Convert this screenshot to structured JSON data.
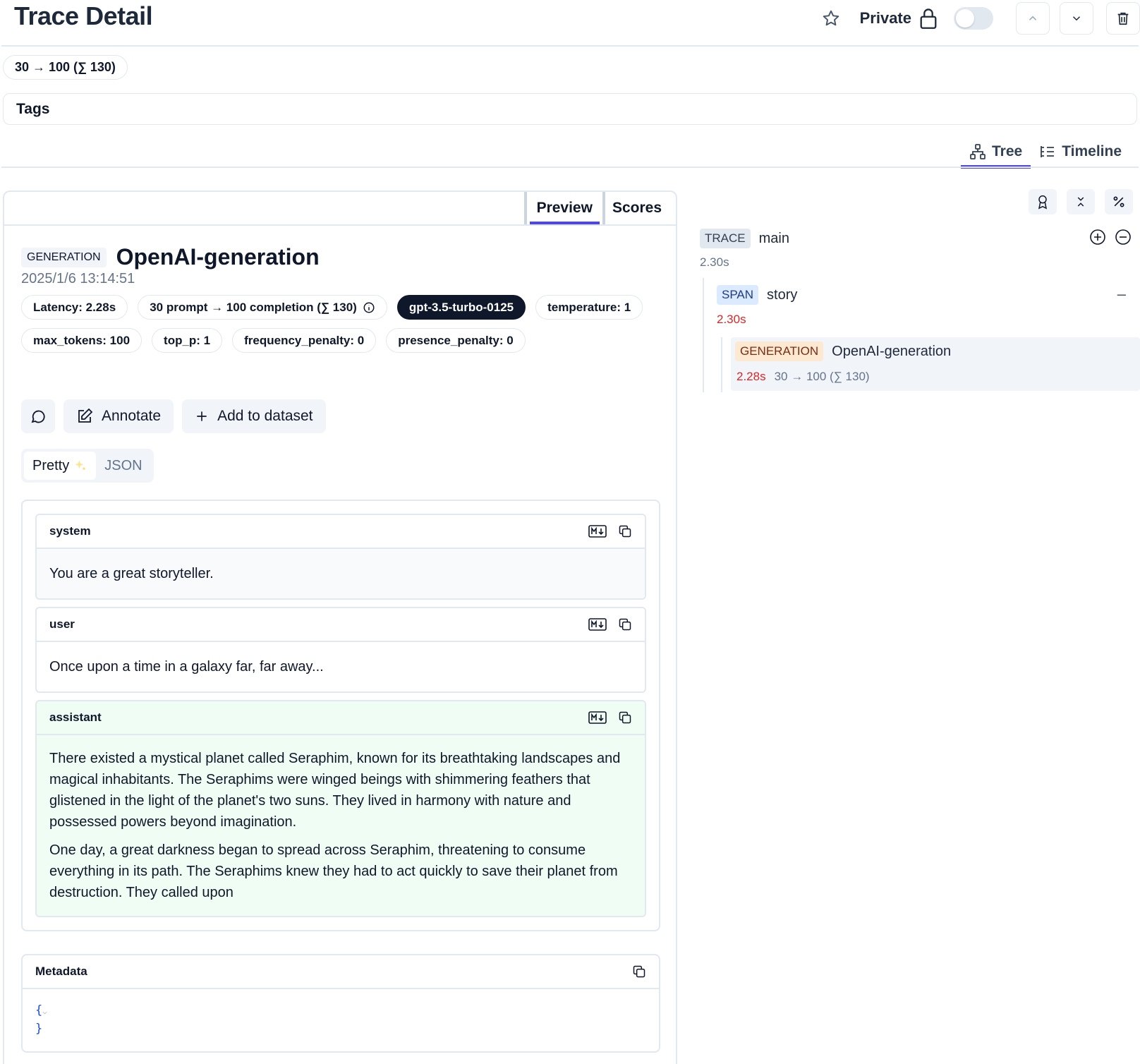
{
  "header": {
    "title": "Trace Detail",
    "private_label": "Private"
  },
  "usage_pill": "30 → 100 (∑ 130)",
  "tags_label": "Tags",
  "view_tabs": [
    {
      "label": "Tree",
      "active": true,
      "icon": "tree-icon"
    },
    {
      "label": "Timeline",
      "active": false,
      "icon": "timeline-icon"
    }
  ],
  "left_panel": {
    "tabs": [
      {
        "label": "Preview",
        "active": true
      },
      {
        "label": "Scores",
        "active": false
      }
    ],
    "observation": {
      "type": "GENERATION",
      "name": "OpenAI-generation",
      "timestamp": "2025/1/6 13:14:51"
    },
    "pills": [
      {
        "label": "Latency: 2.28s"
      },
      {
        "label": "30 prompt → 100 completion (∑ 130)",
        "has_info_icon": true
      },
      {
        "label": "gpt-3.5-turbo-0125",
        "dark": true
      },
      {
        "label": "temperature: 1"
      },
      {
        "label": "max_tokens: 100"
      },
      {
        "label": "top_p: 1"
      },
      {
        "label": "frequency_penalty: 0"
      },
      {
        "label": "presence_penalty: 0"
      }
    ],
    "actions": {
      "annotate": "Annotate",
      "add_to_dataset": "Add to dataset"
    },
    "view_toggle": {
      "pretty": "Pretty",
      "json": "JSON",
      "selected": "Pretty"
    },
    "messages": [
      {
        "role": "system",
        "content": "You are a great storyteller."
      },
      {
        "role": "user",
        "content": "Once upon a time in a galaxy far, far away..."
      },
      {
        "role": "assistant",
        "paragraphs": [
          "There existed a mystical planet called Seraphim, known for its breathtaking landscapes and magical inhabitants. The Seraphims were winged beings with shimmering feathers that glistened in the light of the planet's two suns. They lived in harmony with nature and possessed powers beyond imagination.",
          "One day, a great darkness began to spread across Seraphim, threatening to consume everything in its path. The Seraphims knew they had to act quickly to save their planet from destruction. They called upon"
        ]
      }
    ],
    "metadata": {
      "label": "Metadata",
      "open": "{",
      "close": "}"
    }
  },
  "tree": {
    "trace": {
      "type": "TRACE",
      "name": "main",
      "duration": "2.30s"
    },
    "span": {
      "type": "SPAN",
      "name": "story",
      "duration": "2.30s",
      "collapse": "–"
    },
    "generation": {
      "type": "GENERATION",
      "name": "OpenAI-generation",
      "duration": "2.28s",
      "usage": "30 → 100 (∑ 130)"
    }
  },
  "colors": {
    "accent": "#4f46e5",
    "latency_red": "#dc2626",
    "assistant_bg": "#f0fdf4",
    "model_pill": "#0f172a"
  }
}
